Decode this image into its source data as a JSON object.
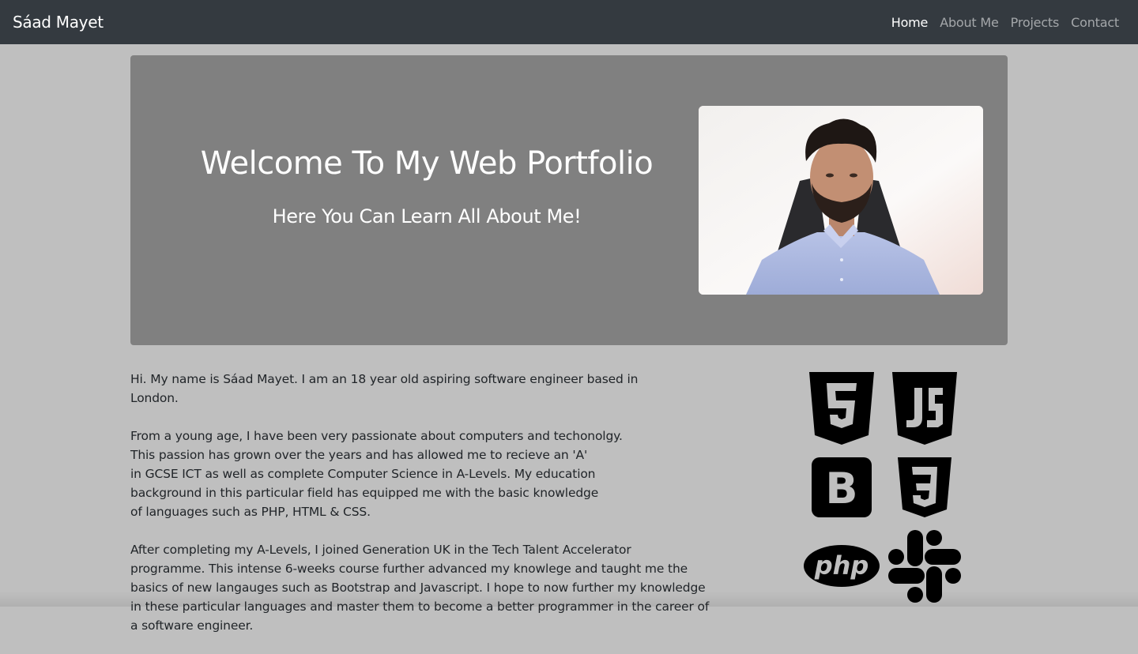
{
  "navbar": {
    "brand": "Sáad Mayet",
    "links": [
      {
        "label": "Home",
        "active": true
      },
      {
        "label": "About Me",
        "active": false
      },
      {
        "label": "Projects",
        "active": false
      },
      {
        "label": "Contact",
        "active": false
      }
    ]
  },
  "hero": {
    "title": "Welcome To My Web Portfolio",
    "subtitle": "Here You Can Learn All About Me!"
  },
  "bio": {
    "intro": "Hi. My name is Sáad Mayet. I am an 18 year old aspiring software engineer based in London.",
    "para2": [
      "From a young age, I have been very passionate about computers and techonolgy.",
      "This passion has grown over the years and has allowed me to recieve an 'A'",
      "in GCSE ICT as well as complete Computer Science in A-Levels. My education",
      "background in this particular field has equipped me with the basic knowledge",
      "of languages such as PHP, HTML & CSS."
    ],
    "para3": [
      "After completing my A-Levels, I joined Generation UK in the Tech Talent Accelerator",
      "programme. This intense 6-weeks course further advanced my knowlege and taught me the",
      "basics of new langauges such as Bootstrap and Javascript. I hope to now further my knowledge",
      "in these particular languages and master them to become a better programmer in the career of",
      "a software engineer."
    ]
  },
  "skills": {
    "icons": [
      "html5-icon",
      "javascript-icon",
      "bootstrap-icon",
      "css3-icon",
      "php-icon",
      "slack-icon"
    ],
    "bootstrap_letter": "B",
    "php_label": "php"
  },
  "colors": {
    "navbar": "#343a40",
    "page_bg": "#bfbfbf",
    "hero_bg": "#808080"
  }
}
